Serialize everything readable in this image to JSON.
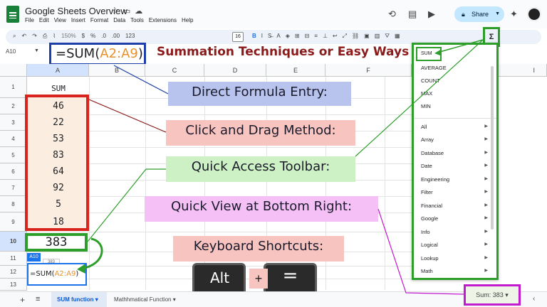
{
  "title_bar": {
    "doc_title": "Google Sheets Overview",
    "menu": [
      "File",
      "Edit",
      "View",
      "Insert",
      "Format",
      "Data",
      "Tools",
      "Extensions",
      "Help"
    ],
    "share_label": "Share"
  },
  "toolbar": {
    "zoom": "150%",
    "currency": "$",
    "percent": "%",
    "decimal_dec": ".0",
    "decimal_inc": ".00",
    "number_format": "123",
    "font_size": "16",
    "bold": "B",
    "sigma": "Σ"
  },
  "formula_bar": {
    "name_box": "A10",
    "formula_prefix": "=SUM(",
    "formula_ref": "A2:A9",
    "formula_suffix": ")"
  },
  "headline": "Summation Techniques or Easy Ways",
  "grid": {
    "columns": [
      "A",
      "B",
      "C",
      "D",
      "E",
      "F",
      "I"
    ],
    "rows": [
      "1",
      "2",
      "3",
      "4",
      "5",
      "6",
      "7",
      "8",
      "9",
      "10",
      "11",
      "12",
      "13"
    ],
    "header_cell": "SUM",
    "values": [
      "46",
      "22",
      "53",
      "83",
      "64",
      "92",
      "5",
      "18"
    ],
    "result": "383",
    "active_cell_tag": "A10",
    "preview_badge": "383",
    "edit_prefix": "=SUM(",
    "edit_ref": "A2:A9",
    "edit_suffix": ")"
  },
  "labels": {
    "direct": "Direct Formula Entry:",
    "click": "Click and Drag Method:",
    "quick": "Quick Access Toolbar:",
    "view": "Quick View at Bottom Right:",
    "keys": "Keyboard Shortcuts:"
  },
  "keys": {
    "alt": "Alt",
    "plus": "+",
    "equals": "="
  },
  "function_menu": {
    "top": [
      "SUM",
      "AVERAGE",
      "COUNT",
      "MAX",
      "MIN"
    ],
    "categories": [
      "All",
      "Array",
      "Database",
      "Date",
      "Engineering",
      "Filter",
      "Financial",
      "Google",
      "Info",
      "Logical",
      "Lookup",
      "Math"
    ]
  },
  "bottom_bar": {
    "tabs": [
      "SUM function",
      "Mathhmatical Function"
    ],
    "sum_chip": "Sum: 383"
  },
  "colors": {
    "formula_border": "#1f3fa8",
    "data_border": "#d9231d",
    "result_border": "#2e9e2a",
    "chip_border": "#c21bcf",
    "headline": "#8b1a1a"
  }
}
